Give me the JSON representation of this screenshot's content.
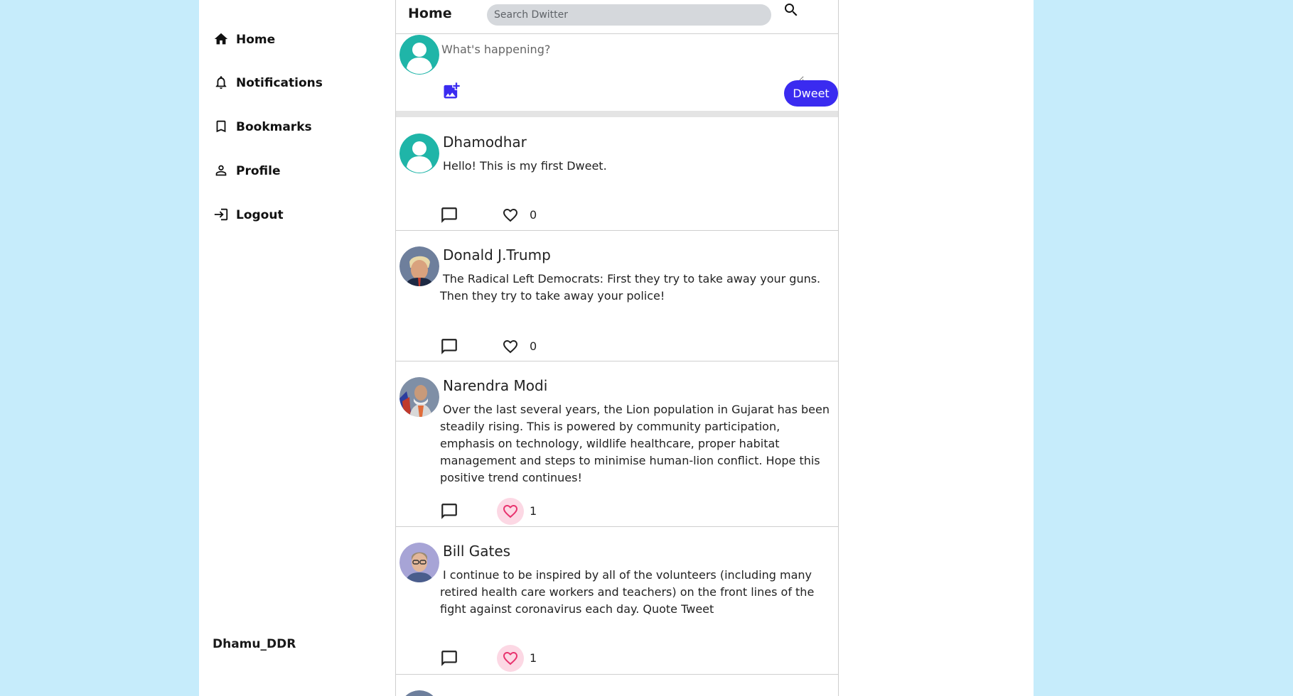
{
  "sidebar": {
    "items": [
      {
        "label": "Home",
        "icon": "home-icon"
      },
      {
        "label": "Notifications",
        "icon": "bell-icon"
      },
      {
        "label": "Bookmarks",
        "icon": "bookmark-icon"
      },
      {
        "label": "Profile",
        "icon": "person-icon"
      },
      {
        "label": "Logout",
        "icon": "logout-icon"
      }
    ],
    "username": "Dhamu_DDR"
  },
  "header": {
    "title": "Home",
    "search_placeholder": "Search Dwitter"
  },
  "composer": {
    "placeholder": "What's happening?",
    "button_label": "Dweet"
  },
  "colors": {
    "accent": "#3a2bf0",
    "like_active": "#e8336e",
    "like_bg": "#fcd8e4",
    "avatar_teal": "#1fb5a8",
    "page_bg": "#c6ecfb"
  },
  "posts": [
    {
      "name": "Dhamodhar",
      "text": "Hello! This is my first Dweet.",
      "likes": "0",
      "liked": false,
      "avatar": "default-avatar"
    },
    {
      "name": "Donald J.Trump",
      "text": "The Radical Left Democrats: First they try to take away your guns. Then they try to take away your police!",
      "likes": "0",
      "liked": false,
      "avatar": "photo-avatar"
    },
    {
      "name": "Narendra Modi",
      "text": "Over the last several years, the Lion population in Gujarat has been steadily rising. This is powered by community participation, emphasis on technology, wildlife healthcare, proper habitat management and steps to minimise human-lion conflict. Hope this positive trend continues!",
      "likes": "1",
      "liked": true,
      "avatar": "photo-avatar"
    },
    {
      "name": "Bill Gates",
      "text": "I continue to be inspired by all of the volunteers (including many retired health care workers and teachers) on the front lines of the fight against coronavirus each day. Quote Tweet",
      "likes": "1",
      "liked": true,
      "avatar": "photo-avatar"
    }
  ]
}
